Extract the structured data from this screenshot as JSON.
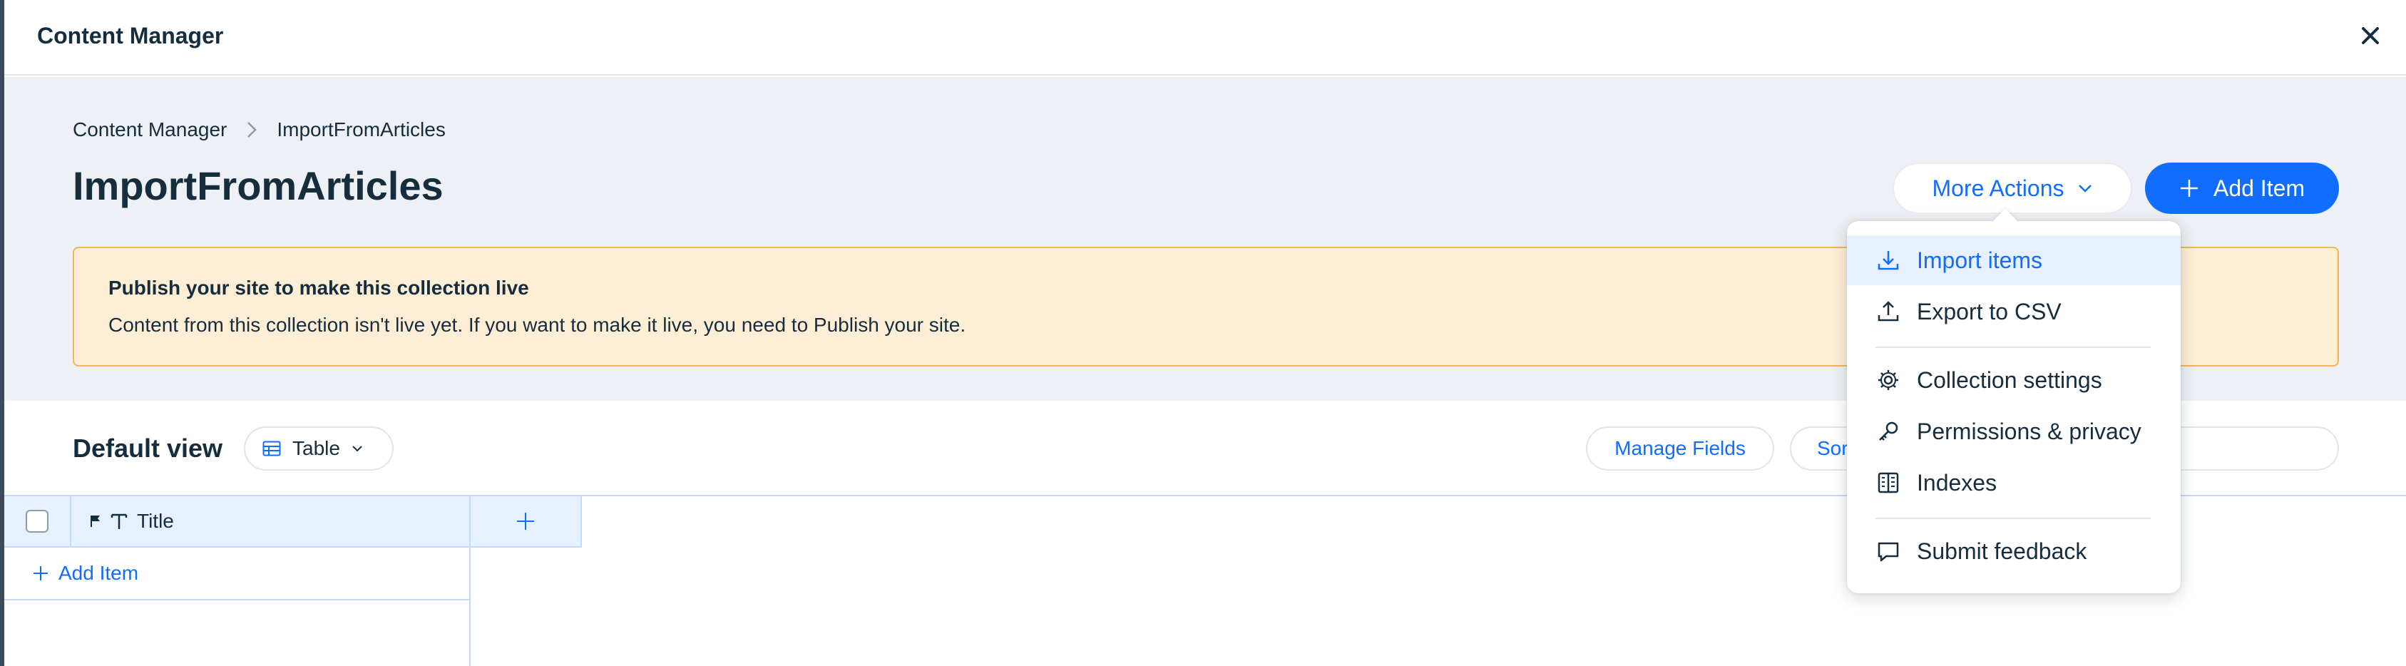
{
  "modal": {
    "title": "Content Manager"
  },
  "breadcrumb": {
    "root": "Content Manager",
    "current": "ImportFromArticles"
  },
  "page": {
    "title": "ImportFromArticles"
  },
  "actions": {
    "more_actions_label": "More Actions",
    "add_item_label": "Add Item"
  },
  "notice": {
    "title": "Publish your site to make this collection live",
    "body": "Content from this collection isn't live yet. If you want to make it live, you need to Publish your site."
  },
  "view": {
    "title": "Default view",
    "selected_view_type": "Table",
    "manage_fields_label": "Manage Fields",
    "sort_label": "Sort"
  },
  "table": {
    "columns": [
      {
        "label": "Title",
        "type_icon": "text-type-icon",
        "primary_icon": "flag-icon"
      }
    ],
    "add_item_label": "Add Item"
  },
  "dropdown": {
    "items": [
      {
        "label": "Import items",
        "icon": "download-icon",
        "active": true
      },
      {
        "label": "Export to CSV",
        "icon": "upload-icon"
      },
      {
        "label": "Collection settings",
        "icon": "gear-icon"
      },
      {
        "label": "Permissions & privacy",
        "icon": "key-icon"
      },
      {
        "label": "Indexes",
        "icon": "indexes-icon"
      },
      {
        "label": "Submit feedback",
        "icon": "chat-icon"
      }
    ]
  },
  "colors": {
    "accent": "#116dff",
    "text": "#162d3d",
    "page_bg": "#edf0f4",
    "notice_bg": "#feeed5",
    "notice_border": "#f0b45a",
    "header_cell_bg": "#e7f0ff"
  }
}
